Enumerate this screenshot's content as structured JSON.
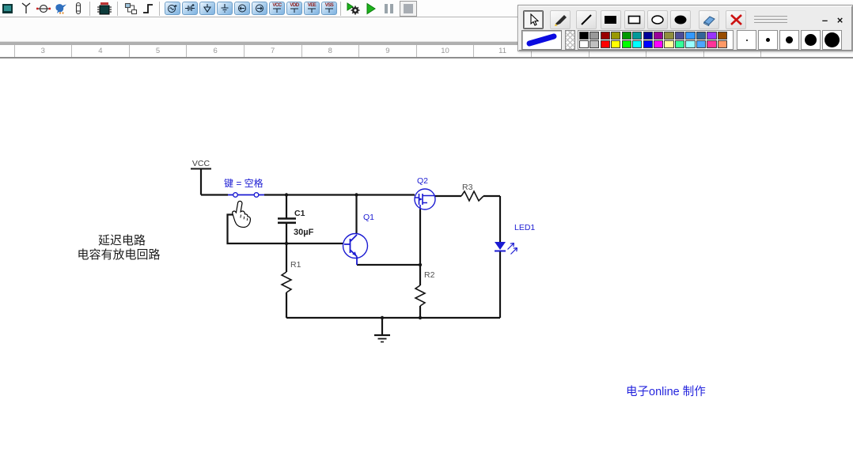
{
  "toolbar": {
    "icons": [
      "display-icon",
      "antenna-icon",
      "diode-icon",
      "bird-icon",
      "capsule-icon",
      "chip-icon",
      "hierarchy-icon",
      "step-signal-icon",
      "ac-source-icon",
      "battery-icon",
      "ground-arrow-icon",
      "earth-ground-icon",
      "source-left-icon",
      "source-right-icon",
      "vcc-rail-icon",
      "vdd-rail-icon",
      "vee-rail-icon",
      "vss-rail-icon",
      "run-settings-icon",
      "run-icon",
      "pause-icon",
      "stop-icon"
    ],
    "power_rails": [
      "VCC",
      "VDD",
      "VEE",
      "VSS"
    ]
  },
  "ruler": {
    "numbers": [
      "3",
      "4",
      "5",
      "6",
      "7",
      "8",
      "9",
      "10",
      "11"
    ]
  },
  "circuit": {
    "labels": {
      "vcc": "VCC",
      "switch_key": "键 = 空格",
      "c1_ref": "C1",
      "c1_value": "30µF",
      "r1_ref": "R1",
      "r2_ref": "R2",
      "r3_ref": "R3",
      "q1_ref": "Q1",
      "q2_ref": "Q2",
      "led_ref": "LED1",
      "note_line1": "延迟电路",
      "note_line2": "电容有放电回路",
      "credit": "电子online 制作"
    },
    "colors": {
      "wire": "#141414",
      "component_blue": "#1b1bd2",
      "label_gray": "#4f4f4f"
    }
  },
  "paint_toolbar": {
    "tools": [
      "select",
      "pen",
      "line",
      "filled-rectangle",
      "rectangle",
      "ellipse",
      "filled-ellipse",
      "eraser",
      "delete-all"
    ],
    "selected_tool": "select",
    "current_color": "#0b0be0",
    "palette_row1": [
      "#000000",
      "#999999",
      "#990000",
      "#999900",
      "#009900",
      "#009999",
      "#000099",
      "#990099",
      "#8f8f3d",
      "#4d4d99",
      "#3399ff",
      "#336699",
      "#9933ff",
      "#994d00"
    ],
    "palette_row2": [
      "#ffffff",
      "#c0c0c0",
      "#ff0000",
      "#ffff00",
      "#00ff00",
      "#00ffff",
      "#0000ff",
      "#ff00ff",
      "#ffff99",
      "#33ff99",
      "#99ffff",
      "#4da6ff",
      "#ff3399",
      "#ff9966"
    ],
    "sizes": [
      2,
      5,
      9,
      15,
      19
    ],
    "minimize_label": "–",
    "close_label": "×"
  }
}
